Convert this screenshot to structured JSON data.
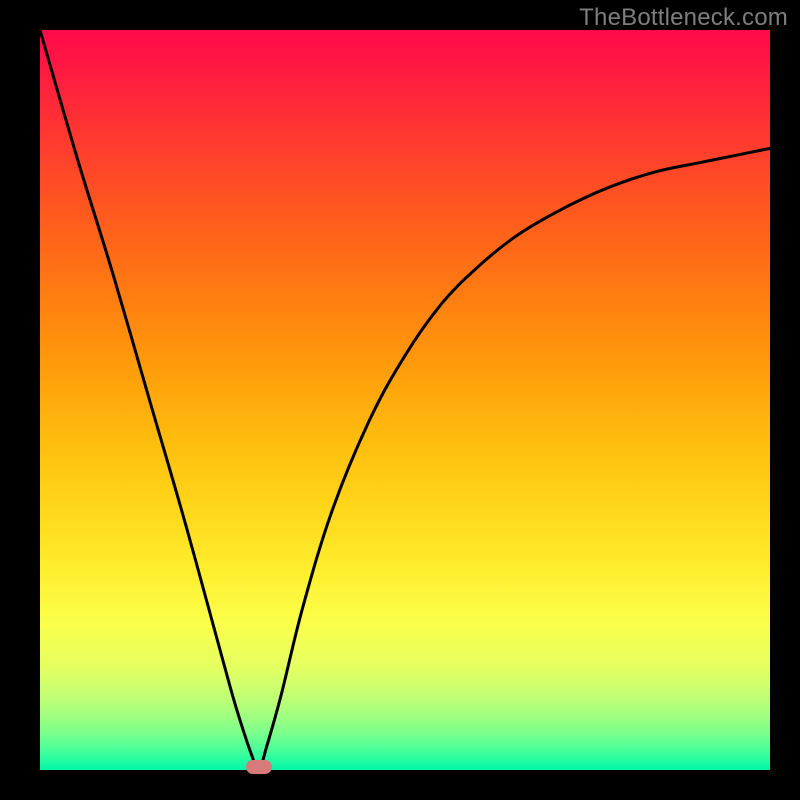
{
  "watermark": "TheBottleneck.com",
  "colors": {
    "frame_bg": "#000000",
    "curve": "#000000",
    "marker": "#d77a7a",
    "watermark": "#7e7e7e"
  },
  "chart_data": {
    "type": "line",
    "title": "",
    "xlabel": "",
    "ylabel": "",
    "xlim": [
      0,
      100
    ],
    "ylim": [
      0,
      100
    ],
    "grid": false,
    "legend": false,
    "gradient_stops": [
      {
        "pos": 0,
        "color": "#ff0a4a"
      },
      {
        "pos": 15,
        "color": "#ff3a2f"
      },
      {
        "pos": 35,
        "color": "#ff7a12"
      },
      {
        "pos": 55,
        "color": "#ffbb0d"
      },
      {
        "pos": 73,
        "color": "#ffee2e"
      },
      {
        "pos": 86,
        "color": "#e6ff60"
      },
      {
        "pos": 95,
        "color": "#7dff8c"
      },
      {
        "pos": 100,
        "color": "#00f6a8"
      }
    ],
    "series": [
      {
        "name": "bottleneck-curve",
        "x": [
          0,
          5,
          10,
          15,
          20,
          25,
          27,
          29,
          30,
          31,
          33,
          36,
          40,
          45,
          50,
          55,
          60,
          65,
          70,
          75,
          80,
          85,
          90,
          95,
          100
        ],
        "y": [
          100,
          83,
          67,
          50,
          33,
          15,
          8,
          2,
          0,
          3,
          10,
          22,
          35,
          47,
          56,
          63,
          68,
          72,
          75,
          77.5,
          79.5,
          81,
          82,
          83,
          84
        ]
      }
    ],
    "marker": {
      "x": 30,
      "y": 0,
      "label": "optimal-point"
    }
  }
}
